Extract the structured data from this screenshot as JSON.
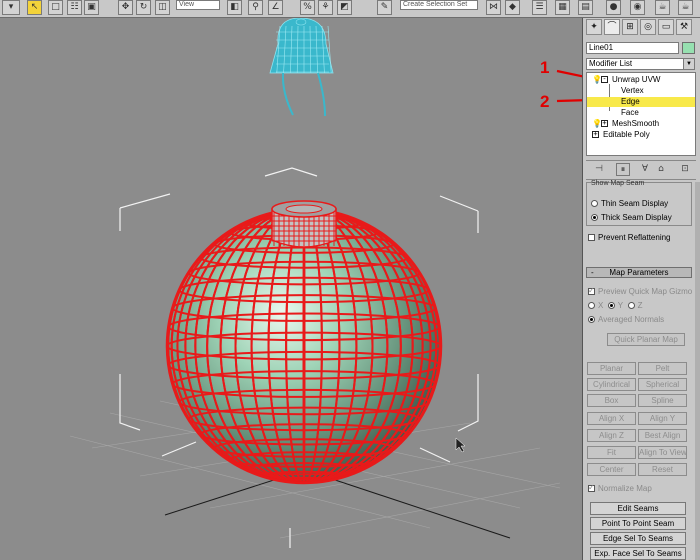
{
  "toolbar": {
    "view_select": "View",
    "selection_set": "Create Selection Set",
    "icons": [
      "undo-arrow-icon",
      "select-arrow-icon",
      "select-region-icon",
      "select-by-name-icon",
      "select-filter-icon",
      "move-icon",
      "rotate-icon",
      "scale-icon",
      "view-select-icon",
      "pivot-icon",
      "snap-icon",
      "angle-snap-icon",
      "percent-snap-icon",
      "spinner-snap-icon",
      "named-selection-icon",
      "mirror-icon",
      "align-icon",
      "layer-icon",
      "curve-editor-icon",
      "schematic-icon",
      "material-editor-icon",
      "render-setup-icon",
      "render-icon"
    ]
  },
  "viewport": {
    "annotation_1": "1",
    "annotation_2": "2"
  },
  "command_panel": {
    "tab_icons": [
      "create-icon",
      "modify-icon",
      "hierarchy-icon",
      "motion-icon",
      "display-icon",
      "utilities-icon"
    ],
    "object_name": "Line01",
    "object_color": "#96e0b0",
    "modifier_list_label": "Modifier List",
    "stack": [
      {
        "label": "Unwrap UVW",
        "level": 0,
        "expander": "⊟",
        "has_bulb": true
      },
      {
        "label": "Vertex",
        "level": 1
      },
      {
        "label": "Edge",
        "level": 1,
        "selected": true
      },
      {
        "label": "Face",
        "level": 1
      },
      {
        "label": "MeshSmooth",
        "level": 0,
        "expander": "+",
        "has_bulb": true
      },
      {
        "label": "Editable Poly",
        "level": 0,
        "expander": "+",
        "has_bulb": false
      }
    ],
    "stack_tools": [
      "pin-stack-icon",
      "show-end-result-icon",
      "make-unique-icon",
      "remove-modifier-icon",
      "configure-sets-icon"
    ],
    "seam_rollout": {
      "header_partial": "Show Map Seam",
      "thin_seam": "Thin Seam Display",
      "thick_seam": "Thick Seam Display",
      "thick_selected": true,
      "prevent_reflattening": "Prevent Reflattening",
      "prevent_reflattening_checked": false
    },
    "map_parameters": {
      "title": "Map Parameters",
      "preview_quick_map": "Preview Quick Map Gizmo",
      "preview_checked": true,
      "axes": [
        "X",
        "Y",
        "Z"
      ],
      "averaged_normals": "Averaged Normals",
      "quick_planar_map": "Quick Planar Map",
      "map_buttons": [
        [
          "Planar",
          "Pelt"
        ],
        [
          "Cylindrical",
          "Spherical"
        ],
        [
          "Box",
          "Spline"
        ],
        [
          "Align X",
          "Align Y"
        ],
        [
          "Align Z",
          "Best Align"
        ],
        [
          "Fit",
          "Align To View"
        ],
        [
          "Center",
          "Reset"
        ]
      ],
      "normalize_map": "Normalize Map",
      "normalize_checked": true,
      "edit_seams": "Edit Seams",
      "point_to_point_seam": "Point To Point Seam",
      "edge_sel_to_seams": "Edge Sel To Seams",
      "exp_face_sel_to_seams": "Exp. Face Sel To Seams"
    }
  },
  "colors": {
    "wireframe": "#e81a1a",
    "cap_wire": "#3ab8cc",
    "highlight": "#f8e94a",
    "annotation": "#e00000"
  }
}
